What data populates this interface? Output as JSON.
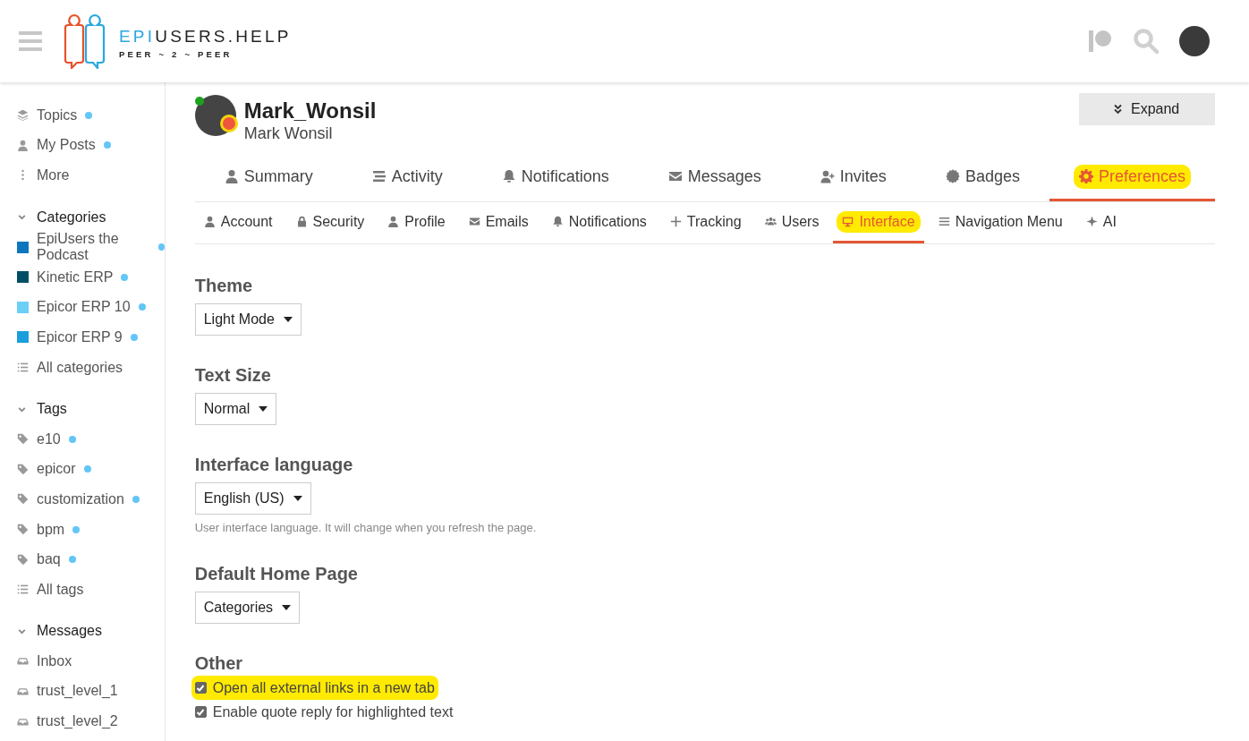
{
  "header": {
    "logo": {
      "accent": "EPI",
      "rest": "USERS.HELP",
      "tagline": "PEER ~ 2 ~ PEER"
    }
  },
  "sidebar": {
    "top_items": [
      {
        "label": "Topics",
        "kind": "topics",
        "unread": true
      },
      {
        "label": "My Posts",
        "kind": "posts",
        "unread": true
      },
      {
        "label": "More",
        "kind": "more",
        "unread": false
      }
    ],
    "sections": [
      {
        "title": "Categories",
        "expanded": true,
        "items": [
          {
            "label": "EpiUsers the Podcast",
            "kind": "category",
            "color": "#0e76bd",
            "unread": true
          },
          {
            "label": "Kinetic ERP",
            "kind": "category",
            "color": "#004d66",
            "unread": true
          },
          {
            "label": "Epicor ERP 10",
            "kind": "category",
            "color": "#6bcff6",
            "unread": true
          },
          {
            "label": "Epicor ERP 9",
            "kind": "category",
            "color": "#1a9fdc",
            "unread": true
          },
          {
            "label": "All categories",
            "kind": "list",
            "unread": false
          }
        ]
      },
      {
        "title": "Tags",
        "expanded": true,
        "items": [
          {
            "label": "e10",
            "kind": "tag",
            "unread": true
          },
          {
            "label": "epicor",
            "kind": "tag",
            "unread": true
          },
          {
            "label": "customization",
            "kind": "tag",
            "unread": true
          },
          {
            "label": "bpm",
            "kind": "tag",
            "unread": true
          },
          {
            "label": "baq",
            "kind": "tag",
            "unread": true
          },
          {
            "label": "All tags",
            "kind": "list",
            "unread": false
          }
        ]
      },
      {
        "title": "Messages",
        "expanded": true,
        "items": [
          {
            "label": "Inbox",
            "kind": "inbox",
            "unread": false
          },
          {
            "label": "trust_level_1",
            "kind": "inbox",
            "unread": false
          },
          {
            "label": "trust_level_2",
            "kind": "inbox",
            "unread": false
          }
        ]
      }
    ]
  },
  "profile": {
    "username": "Mark_Wonsil",
    "full_name": "Mark Wonsil",
    "online": true,
    "expand_button": "Expand"
  },
  "main_tabs": [
    {
      "label": "Summary",
      "kind": "user",
      "selected": false,
      "highlighted": false
    },
    {
      "label": "Activity",
      "kind": "stream",
      "selected": false,
      "highlighted": false
    },
    {
      "label": "Notifications",
      "kind": "bell",
      "selected": false,
      "highlighted": false
    },
    {
      "label": "Messages",
      "kind": "envelope",
      "selected": false,
      "highlighted": false
    },
    {
      "label": "Invites",
      "kind": "user-plus",
      "selected": false,
      "highlighted": false
    },
    {
      "label": "Badges",
      "kind": "badge",
      "selected": false,
      "highlighted": false
    },
    {
      "label": "Preferences",
      "kind": "gear",
      "selected": true,
      "highlighted": true
    }
  ],
  "sub_tabs": [
    {
      "label": "Account",
      "kind": "user",
      "selected": false,
      "highlighted": false
    },
    {
      "label": "Security",
      "kind": "lock",
      "selected": false,
      "highlighted": false
    },
    {
      "label": "Profile",
      "kind": "user",
      "selected": false,
      "highlighted": false
    },
    {
      "label": "Emails",
      "kind": "envelope",
      "selected": false,
      "highlighted": false
    },
    {
      "label": "Notifications",
      "kind": "bell",
      "selected": false,
      "highlighted": false
    },
    {
      "label": "Tracking",
      "kind": "plus",
      "selected": false,
      "highlighted": false
    },
    {
      "label": "Users",
      "kind": "users",
      "selected": false,
      "highlighted": false
    },
    {
      "label": "Interface",
      "kind": "monitor",
      "selected": true,
      "highlighted": true
    },
    {
      "label": "Navigation Menu",
      "kind": "bars",
      "selected": false,
      "highlighted": false
    },
    {
      "label": "AI",
      "kind": "sparkle",
      "selected": false,
      "highlighted": false
    }
  ],
  "settings": [
    {
      "title": "Theme",
      "value": "Light Mode"
    },
    {
      "title": "Text Size",
      "value": "Normal"
    },
    {
      "title": "Interface language",
      "value": "English (US)",
      "help": "User interface language. It will change when you refresh the page."
    },
    {
      "title": "Default Home Page",
      "value": "Categories"
    }
  ],
  "other": {
    "title": "Other",
    "options": [
      {
        "label": "Open all external links in a new tab",
        "checked": true,
        "highlighted": true
      },
      {
        "label": "Enable quote reply for highlighted text",
        "checked": true,
        "highlighted": false
      }
    ]
  }
}
